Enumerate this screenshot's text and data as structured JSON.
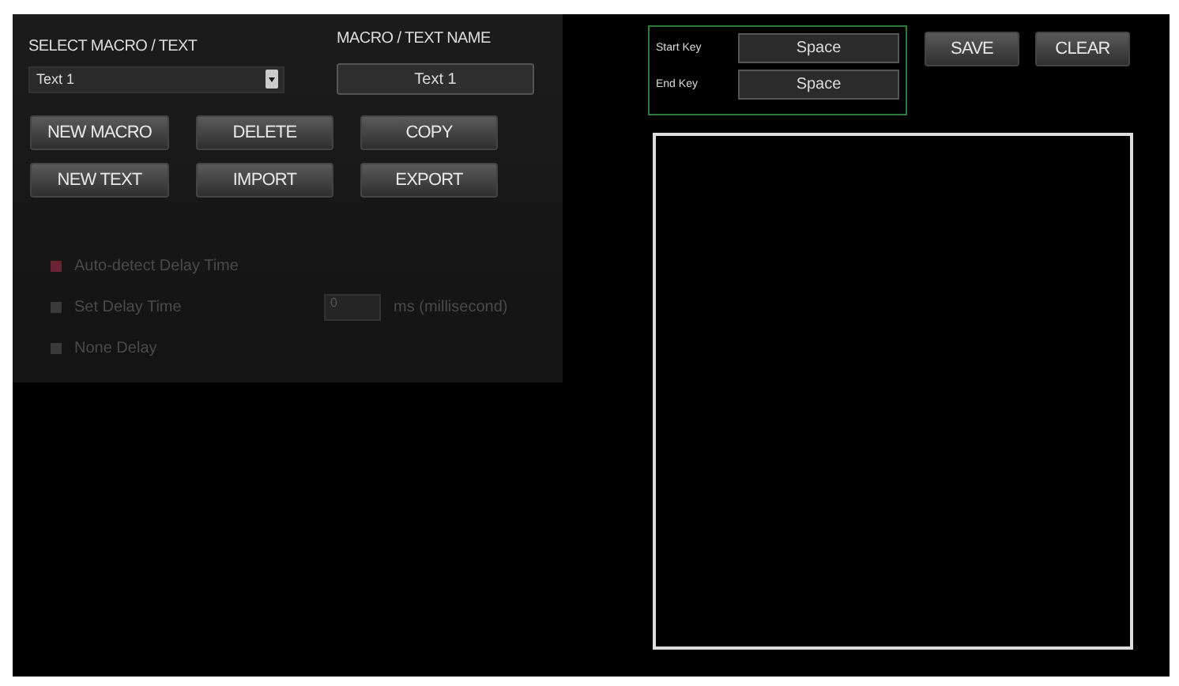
{
  "select_macro": {
    "label": "SELECT MACRO / TEXT",
    "value": "Text 1"
  },
  "macro_name": {
    "label": "MACRO / TEXT NAME",
    "value": "Text 1"
  },
  "buttons": [
    "NEW MACRO",
    "DELETE",
    "COPY",
    "NEW TEXT",
    "IMPORT",
    "EXPORT"
  ],
  "delay_options": [
    {
      "label": "Auto-detect Delay Time",
      "selected": true,
      "disabled": true
    },
    {
      "label": "Set Delay Time",
      "selected": false,
      "disabled": true,
      "value": "0",
      "unit": "ms (millisecond)"
    },
    {
      "label": "None Delay",
      "selected": false,
      "disabled": true
    }
  ],
  "keys": [
    {
      "label": "Start Key",
      "value": "Space"
    },
    {
      "label": "End Key",
      "value": "Space"
    }
  ],
  "actions": [
    "SAVE",
    "CLEAR"
  ]
}
